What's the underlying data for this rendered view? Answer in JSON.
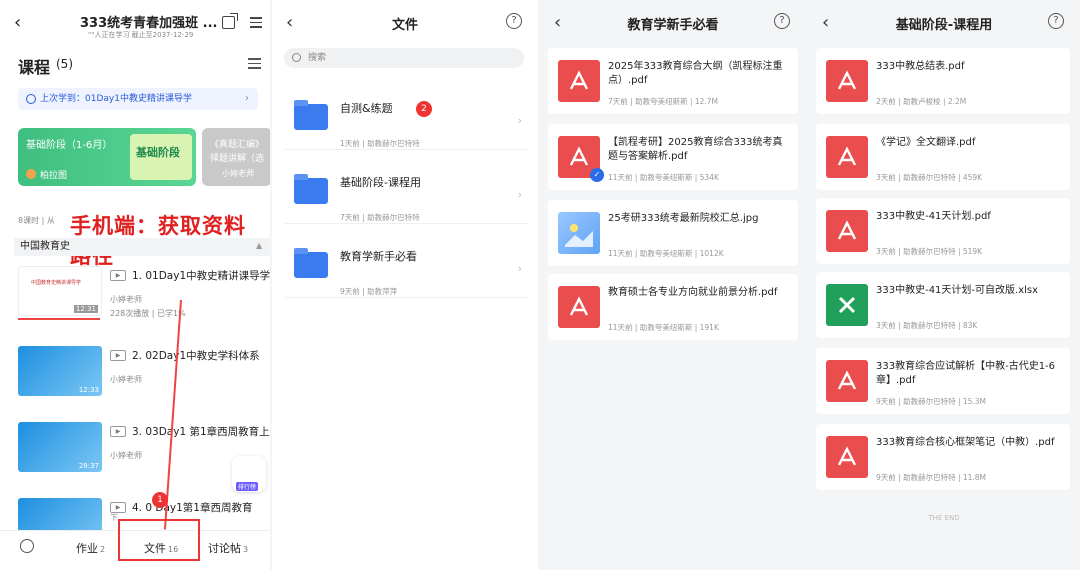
{
  "panel1": {
    "course_title": "333统考青春加强班 ...",
    "course_sub": "\"\"人正在学习 截止至2037-12-29",
    "courses_label": "课程",
    "courses_count": "(5)",
    "last_learn": "上次学到：01Day1中教史精讲课导学",
    "card1_title": "基础阶段（1-6月）",
    "card1_badge": "基础阶段",
    "card1_user": "柏拉图",
    "card2_title": "《真题汇编》择题讲解（选",
    "card2_user": "小婷老师",
    "meta": "8课时 | 从",
    "overlay": "手机端：获取资料路径",
    "section": "中国教育史",
    "lessons": [
      {
        "name": "1. 01Day1中教史精讲课导学",
        "teacher": "小婷老师",
        "stats": "228次播放 | 已学1%",
        "dur": "12:31",
        "thumb_text": "中国教育史精讲课导学"
      },
      {
        "name": "2. 02Day1中教史学科体系",
        "teacher": "小婷老师",
        "stats": "",
        "dur": "12:33"
      },
      {
        "name": "3. 03Day1 第1章西周教育上",
        "teacher": "小婷老师",
        "stats": "",
        "dur": "28:37"
      },
      {
        "name": "4. 0 Day1第1章西周教育",
        "teacher": "下",
        "stats": "",
        "dur": ""
      }
    ],
    "rank": "排行榜",
    "tabs": {
      "homework": "作业",
      "homework_count": "2",
      "files": "文件",
      "files_count": "16",
      "forum": "讨论帖",
      "forum_count": "3"
    },
    "step1": "1"
  },
  "panel2": {
    "title": "文件",
    "search_placeholder": "搜索",
    "folders": [
      {
        "name": "自测&练题",
        "meta": "1天前 | 助教赫尔巴特特"
      },
      {
        "name": "基础阶段-课程用",
        "meta": "7天前 | 助教赫尔巴特特"
      },
      {
        "name": "教育学新手必看",
        "meta": "9天前 | 助教萍萍"
      }
    ],
    "step2": "2"
  },
  "panel3": {
    "title": "教育学新手必看",
    "files": [
      {
        "name": "2025年333教育综合大纲（凯程标注重点）.pdf",
        "meta": "7天前 | 助教夸美纽斯斯 | 12.7M",
        "type": "pdf"
      },
      {
        "name": "【凯程考研】2025教育综合333统考真题与答案解析.pdf",
        "meta": "11天前 | 助教夸美纽斯斯 | 534K",
        "type": "pdf"
      },
      {
        "name": "25考研333统考最新院校汇总.jpg",
        "meta": "11天前 | 助教夸美纽斯斯 | 1012K",
        "type": "img"
      },
      {
        "name": "教育硕士各专业方向就业前景分析.pdf",
        "meta": "11天前 | 助教夸美纽斯斯 | 191K",
        "type": "pdf"
      }
    ]
  },
  "panel4": {
    "title": "基础阶段-课程用",
    "files": [
      {
        "name": "333中教总结表.pdf",
        "meta": "2天前 | 助教卢梭梭 | 2.2M",
        "type": "pdf"
      },
      {
        "name": "《学记》全文翻译.pdf",
        "meta": "3天前 | 助教赫尔巴特特 | 459K",
        "type": "pdf"
      },
      {
        "name": "333中教史-41天计划.pdf",
        "meta": "3天前 | 助教赫尔巴特特 | 519K",
        "type": "pdf"
      },
      {
        "name": "333中教史-41天计划-可自改版.xlsx",
        "meta": "3天前 | 助教赫尔巴特特 | 83K",
        "type": "xls"
      },
      {
        "name": "333教育综合应试解析【中教-古代史1-6章】.pdf",
        "meta": "9天前 | 助教赫尔巴特特 | 15.3M",
        "type": "pdf"
      },
      {
        "name": "333教育综合核心框架笔记（中教）.pdf",
        "meta": "9天前 | 助教赫尔巴特特 | 11.8M",
        "type": "pdf"
      }
    ],
    "end": "THE END"
  },
  "colors": {
    "accent": "#2b6de8",
    "pdf": "#ea4d4d",
    "xls": "#21a05b",
    "highlight": "#e33333"
  }
}
